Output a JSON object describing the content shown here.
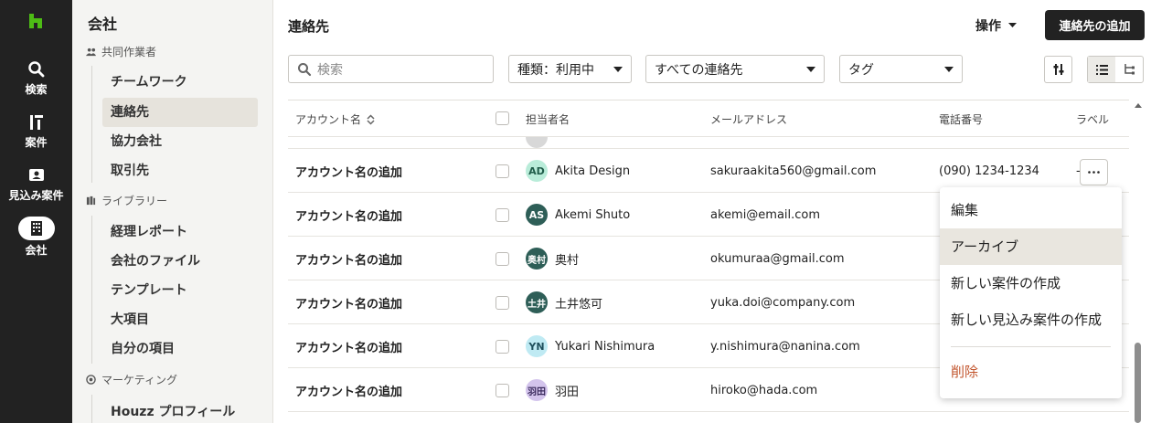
{
  "rail": {
    "items": [
      {
        "label": "検索",
        "icon": "search-icon"
      },
      {
        "label": "案件",
        "icon": "projects-icon"
      },
      {
        "label": "見込み案件",
        "icon": "leads-icon"
      },
      {
        "label": "会社",
        "icon": "building-icon"
      }
    ]
  },
  "sidebar": {
    "title": "会社",
    "sections": [
      {
        "label": "共同作業者",
        "icon": "people-icon",
        "items": [
          "チームワーク",
          "連絡先",
          "協力会社",
          "取引先"
        ]
      },
      {
        "label": "ライブラリー",
        "icon": "library-icon",
        "items": [
          "経理レポート",
          "会社のファイル",
          "テンプレート",
          "大項目",
          "自分の項目"
        ]
      },
      {
        "label": "マーケティング",
        "icon": "marketing-icon",
        "items": [
          "Houzz プロフィール"
        ]
      }
    ],
    "active_item": "連絡先"
  },
  "header": {
    "title": "連絡先",
    "ops_label": "操作",
    "add_button": "連絡先の追加"
  },
  "filters": {
    "search_placeholder": "検索",
    "type_filter": "種類：利用中",
    "contacts_filter": "すべての連絡先",
    "tag_filter": "タグ"
  },
  "table": {
    "columns": [
      "アカウント名",
      "担当者名",
      "メールアドレス",
      "電話番号",
      "ラベル"
    ],
    "rows": [
      {
        "account": "アカウント名の追加",
        "initials": "AD",
        "name": "Akita Design",
        "email": "sakuraakita560@gmail.com",
        "phone": "(090) 1234-1234",
        "label": "-",
        "avatar_bg": "#b9ecd9",
        "avatar_fg": "#1f5c49"
      },
      {
        "account": "アカウント名の追加",
        "initials": "AS",
        "name": "Akemi Shuto",
        "email": "akemi@email.com",
        "phone": "",
        "label": "",
        "avatar_bg": "#2e5e57",
        "avatar_fg": "#ffffff"
      },
      {
        "account": "アカウント名の追加",
        "initials": "奥村",
        "name": "奥村",
        "email": "okumuraa@gmail.com",
        "phone": "",
        "label": "",
        "avatar_bg": "#2e5e57",
        "avatar_fg": "#ffffff"
      },
      {
        "account": "アカウント名の追加",
        "initials": "土井",
        "name": "土井悠可",
        "email": "yuka.doi@company.com",
        "phone": "",
        "label": "",
        "avatar_bg": "#2e5e57",
        "avatar_fg": "#ffffff"
      },
      {
        "account": "アカウント名の追加",
        "initials": "YN",
        "name": "Yukari Nishimura",
        "email": "y.nishimura@nanina.com",
        "phone": "",
        "label": "",
        "avatar_bg": "#bfeaf3",
        "avatar_fg": "#1f4f5c"
      },
      {
        "account": "アカウント名の追加",
        "initials": "羽田",
        "name": "羽田",
        "email": "hiroko@hada.com",
        "phone": "",
        "label": "",
        "avatar_bg": "#d3c4ec",
        "avatar_fg": "#3a2a5c"
      }
    ]
  },
  "menu": {
    "items": [
      "編集",
      "アーカイブ",
      "新しい案件の作成",
      "新しい見込み案件の作成"
    ],
    "hovered": "アーカイブ",
    "danger_item": "削除"
  },
  "colors": {
    "rail_bg": "#222222",
    "sidebar_bg": "#f4f4f2",
    "primary_button": "#222222",
    "danger": "#c2552d"
  }
}
